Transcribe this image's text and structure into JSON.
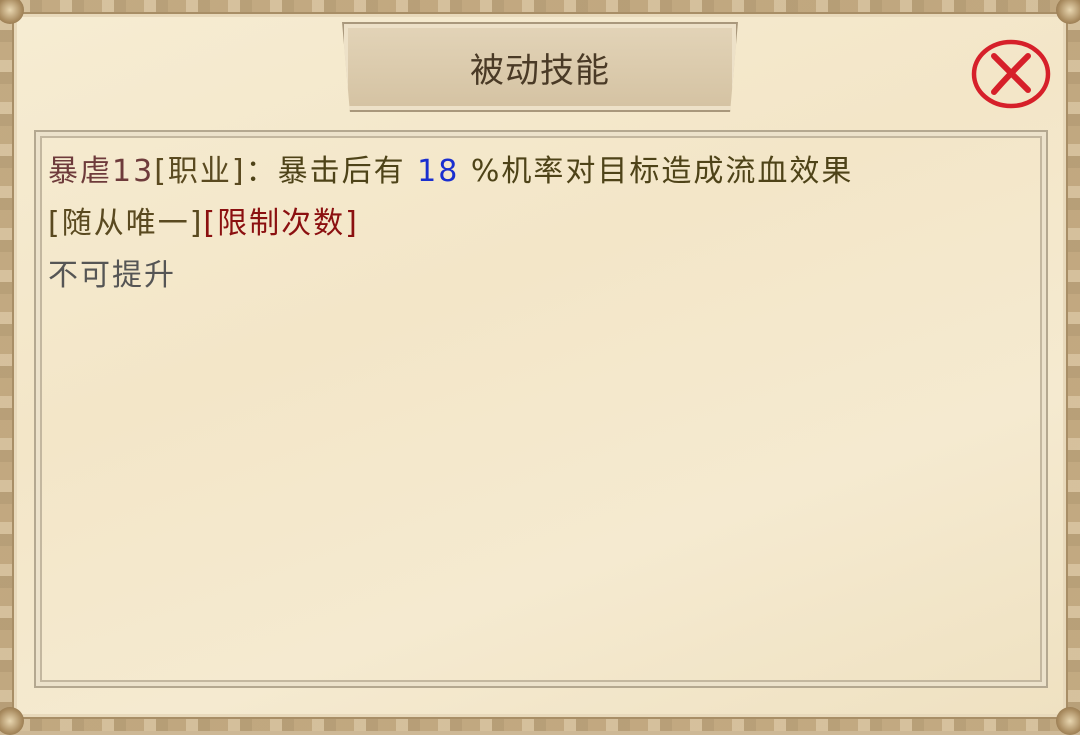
{
  "window": {
    "title": "被动技能"
  },
  "close_button": {
    "icon": "close-x-icon",
    "color": "#d6202a"
  },
  "skill": {
    "name": "暴虐13",
    "class_tag": "[职业]",
    "separator": "：",
    "desc_before": "暴击后有",
    "chance_value": "18",
    "desc_after": "%机率对目标造成流血效果",
    "tag_follower": "[随从唯一]",
    "tag_limit": "[限制次数]",
    "upgrade_status": "不可提升"
  },
  "colors": {
    "skill_name": "#6e3b3b",
    "description": "#4e4318",
    "chance_value": "#1a2fcf",
    "limit_tag": "#8b1010",
    "status": "#555555"
  }
}
